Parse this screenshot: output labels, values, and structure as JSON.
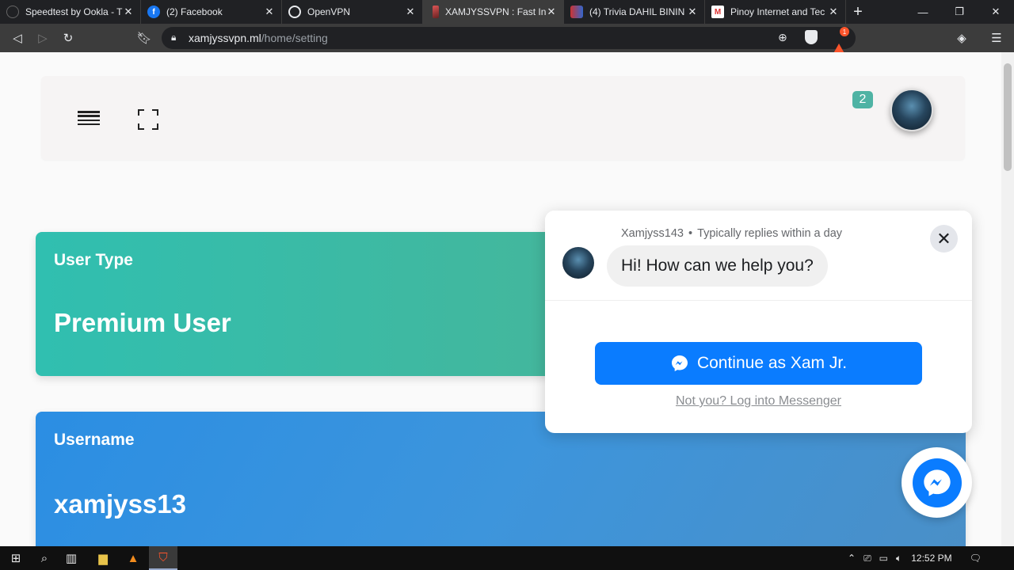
{
  "browser": {
    "tabs": [
      {
        "title": "Speedtest by Ookla - T",
        "active": false
      },
      {
        "title": "(2) Facebook",
        "active": false
      },
      {
        "title": "OpenVPN",
        "active": false
      },
      {
        "title": "XAMJYSSVPN : Fast Int",
        "active": true
      },
      {
        "title": "(4) Trivia DAHIL BININ",
        "active": false
      },
      {
        "title": "Pinoy Internet and Tec",
        "active": false
      }
    ],
    "url_host": "xamjyssvpn.ml",
    "url_path": "/home/setting",
    "rewards_count": "1"
  },
  "header": {
    "notification_count": "2"
  },
  "cards": {
    "user_type": {
      "label": "User Type",
      "value": "Premium User"
    },
    "username": {
      "label": "Username",
      "value": "xamjyss13"
    }
  },
  "chat": {
    "sender": "Xamjyss143",
    "reply_time": "Typically replies within a day",
    "greeting": "Hi! How can we help you?",
    "continue_label": "Continue as Xam Jr.",
    "not_you_label": "Not you? Log into Messenger"
  },
  "taskbar": {
    "time": "12:52 PM"
  },
  "colors": {
    "user_type_card": "#30bfb0",
    "username_card": "#2b8ee3",
    "messenger_blue": "#0a7cff",
    "badge": "#4fb3a4"
  }
}
